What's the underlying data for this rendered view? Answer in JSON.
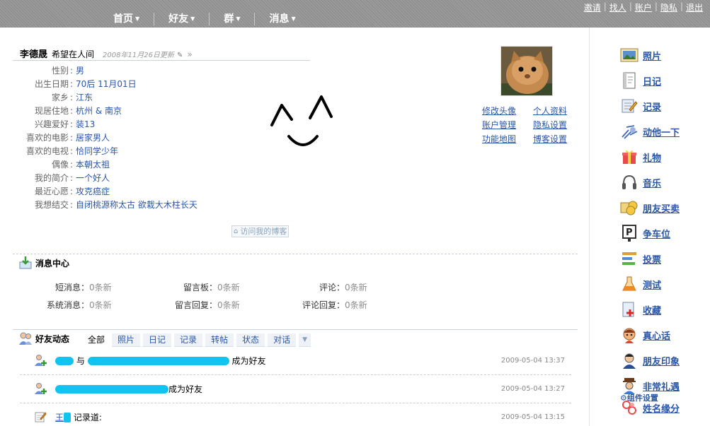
{
  "nav": {
    "items": [
      {
        "label": "首页"
      },
      {
        "label": "好友"
      },
      {
        "label": "群"
      },
      {
        "label": "消息"
      }
    ],
    "links": [
      "邀请",
      "找人",
      "账户",
      "隐私",
      "退出"
    ]
  },
  "profile": {
    "name": "李德晟",
    "status": "希望在人间",
    "updated": "2008年11月26日更新",
    "fields": [
      {
        "key": "性别",
        "value": "男"
      },
      {
        "key": "出生日期",
        "value": "70后 11月01日"
      },
      {
        "key": "家乡",
        "value": "江东"
      },
      {
        "key": "现居住地",
        "value": "杭州 & 南京"
      },
      {
        "key": "兴趣爱好",
        "value": "装13"
      },
      {
        "key": "喜欢的电影",
        "value": "居家男人"
      },
      {
        "key": "喜欢的电视",
        "value": "恰同学少年"
      },
      {
        "key": "偶像",
        "value": "本朝太祖"
      },
      {
        "key": "我的简介",
        "value": "一个好人"
      },
      {
        "key": "最近心愿",
        "value": "攻克癌症"
      },
      {
        "key": "我想结交",
        "value": "自闭桃源称太古 欲栽大木柱长天"
      }
    ],
    "links": [
      "修改头像",
      "个人资料",
      "账户管理",
      "隐私设置",
      "功能地图",
      "博客设置"
    ],
    "visit_blog": "访问我的博客"
  },
  "messages": {
    "title": "消息中心",
    "items": [
      {
        "key": "短消息",
        "value": "0条新"
      },
      {
        "key": "留言板",
        "value": "0条新"
      },
      {
        "key": "评论",
        "value": "0条新"
      },
      {
        "key": "系统消息",
        "value": "0条新"
      },
      {
        "key": "留言回复",
        "value": "0条新"
      },
      {
        "key": "评论回复",
        "value": "0条新"
      }
    ]
  },
  "feed": {
    "title": "好友动态",
    "tabs": [
      "全部",
      "照片",
      "日记",
      "记录",
      "转帖",
      "状态",
      "对话"
    ],
    "rows": [
      {
        "mid": "与",
        "suffix": "成为好友",
        "time": "2009-05-04 13:37"
      },
      {
        "suffix": "成为好友",
        "time": "2009-05-04 13:27"
      },
      {
        "name": "王",
        "suffix": "记录道:",
        "time": "2009-05-04 13:15"
      }
    ]
  },
  "sidebar": {
    "apps": [
      {
        "label": "照片",
        "icon": "photo-icon"
      },
      {
        "label": "日记",
        "icon": "diary-icon"
      },
      {
        "label": "记录",
        "icon": "note-icon"
      },
      {
        "label": "动他一下",
        "icon": "poke-icon"
      },
      {
        "label": "礼物",
        "icon": "gift-icon"
      },
      {
        "label": "音乐",
        "icon": "headphones-icon"
      },
      {
        "label": "朋友买卖",
        "icon": "coins-icon"
      },
      {
        "label": "争车位",
        "icon": "parking-icon"
      },
      {
        "label": "投票",
        "icon": "vote-icon"
      },
      {
        "label": "测试",
        "icon": "flask-icon"
      },
      {
        "label": "收藏",
        "icon": "bookmark-icon"
      },
      {
        "label": "真心话",
        "icon": "truth-icon"
      },
      {
        "label": "朋友印象",
        "icon": "impression-icon"
      },
      {
        "label": "非常礼遇",
        "icon": "courtesy-icon"
      }
    ],
    "settings": "组件设置",
    "last": "姓名缘分"
  }
}
